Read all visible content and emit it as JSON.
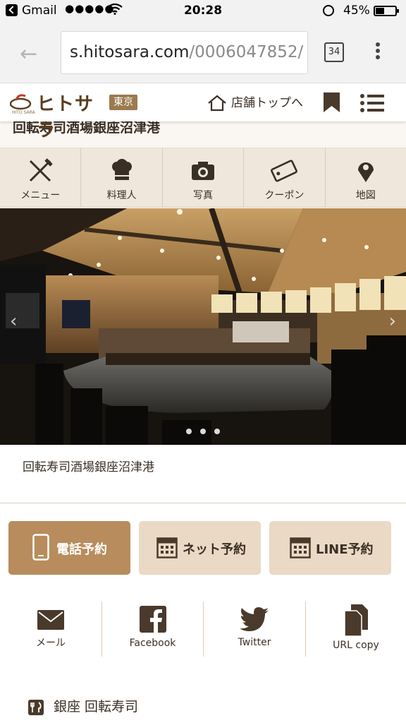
{
  "status_bar": {
    "back_app": "Gmail",
    "signal": "●●●●●",
    "time": "20:28",
    "battery": "45%"
  },
  "browser": {
    "url_host": "s.hitosara.com",
    "url_path": "/0006047852/",
    "tab_count": "34"
  },
  "header": {
    "logo_text": "ヒトサラ",
    "logo_sub": "HITO SARA",
    "area_badge": "東京",
    "store_top_label": "店舗トップへ"
  },
  "store": {
    "name": "回転寿司酒場銀座沼津港",
    "photo_caption": "回転寿司酒場銀座沼津港",
    "category": "銀座 回転寿司"
  },
  "tabs": [
    {
      "label": "メニュー",
      "icon": "fork-knife-icon"
    },
    {
      "label": "料理人",
      "icon": "chef-hat-icon"
    },
    {
      "label": "写真",
      "icon": "camera-icon"
    },
    {
      "label": "クーポン",
      "icon": "coupon-icon"
    },
    {
      "label": "地図",
      "icon": "map-pin-icon"
    }
  ],
  "reservation": {
    "phone": "電話予約",
    "net": "ネット予約",
    "line": "LINE予約"
  },
  "share": {
    "mail": "メール",
    "facebook": "Facebook",
    "twitter": "Twitter",
    "url_copy": "URL copy"
  },
  "photo": {
    "slide_count": 3
  },
  "colors": {
    "accent": "#b88c5c",
    "button_bg": "#ead9c5",
    "tab_bg": "#efe7dc",
    "text": "#3a2f25"
  }
}
